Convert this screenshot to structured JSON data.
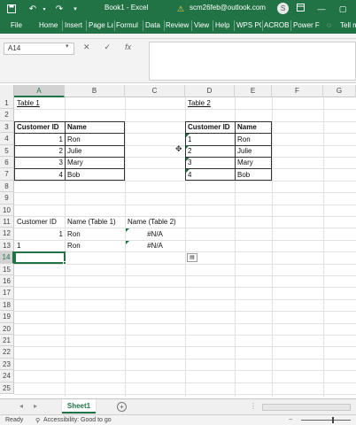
{
  "titlebar": {
    "title": "Book1 - Excel",
    "user": "scm26feb@outlook.com",
    "avatar": "S",
    "icons": [
      "save-icon",
      "undo-icon",
      "redo-icon",
      "warning-icon",
      "ribbon-display-icon",
      "minimize-icon",
      "maximize-icon"
    ]
  },
  "ribbon": {
    "tabs": [
      "File",
      "Home",
      "Insert",
      "Page La",
      "Formul",
      "Data",
      "Review",
      "View",
      "Help",
      "WPS PC",
      "ACROB",
      "Power F",
      "Tell m"
    ]
  },
  "formula_bar": {
    "name_box": "A14",
    "cancel_symbol": "✕",
    "enter_symbol": "✓",
    "fx_symbol": "fx",
    "value": ""
  },
  "columns": [
    "A",
    "B",
    "C",
    "D",
    "E",
    "F",
    "G"
  ],
  "rows": [
    "1",
    "2",
    "3",
    "4",
    "5",
    "6",
    "7",
    "8",
    "9",
    "10",
    "11",
    "12",
    "13",
    "14",
    "15",
    "16",
    "17",
    "18",
    "19",
    "20",
    "21",
    "22",
    "23",
    "24",
    "25"
  ],
  "selected": {
    "column": "A",
    "row": "14"
  },
  "cells": {
    "table1_title": "Table 1",
    "table2_title": "Table 2",
    "t1_header_id": "Customer ID",
    "t1_header_name": "Name",
    "t2_header_id": "Customer ID",
    "t2_header_name": "Name",
    "t1_rows": [
      {
        "id": "1",
        "name": "Ron"
      },
      {
        "id": "2",
        "name": "Julie"
      },
      {
        "id": "3",
        "name": "Mary"
      },
      {
        "id": "4",
        "name": "Bob"
      }
    ],
    "t2_rows": [
      {
        "id": "1",
        "name": "Ron"
      },
      {
        "id": "2",
        "name": "Julie"
      },
      {
        "id": "3",
        "name": "Mary"
      },
      {
        "id": "4",
        "name": "Bob"
      }
    ],
    "lookup_header_id": "Customer ID",
    "lookup_header_name1": "Name (Table 1)",
    "lookup_header_name2": "Name (Table 2)",
    "lookup_rows": [
      {
        "id": "1",
        "name1": "Ron",
        "name2": "#N/A"
      },
      {
        "id": "1",
        "name1": "Ron",
        "name2": "#N/A"
      }
    ]
  },
  "sheet_tabs": {
    "active": "Sheet1",
    "add_symbol": "+"
  },
  "status": {
    "ready": "Ready",
    "accessibility": "Accessibility: Good to go"
  },
  "colors": {
    "excel_green": "#217346",
    "error_triangle": "#1e7145"
  }
}
